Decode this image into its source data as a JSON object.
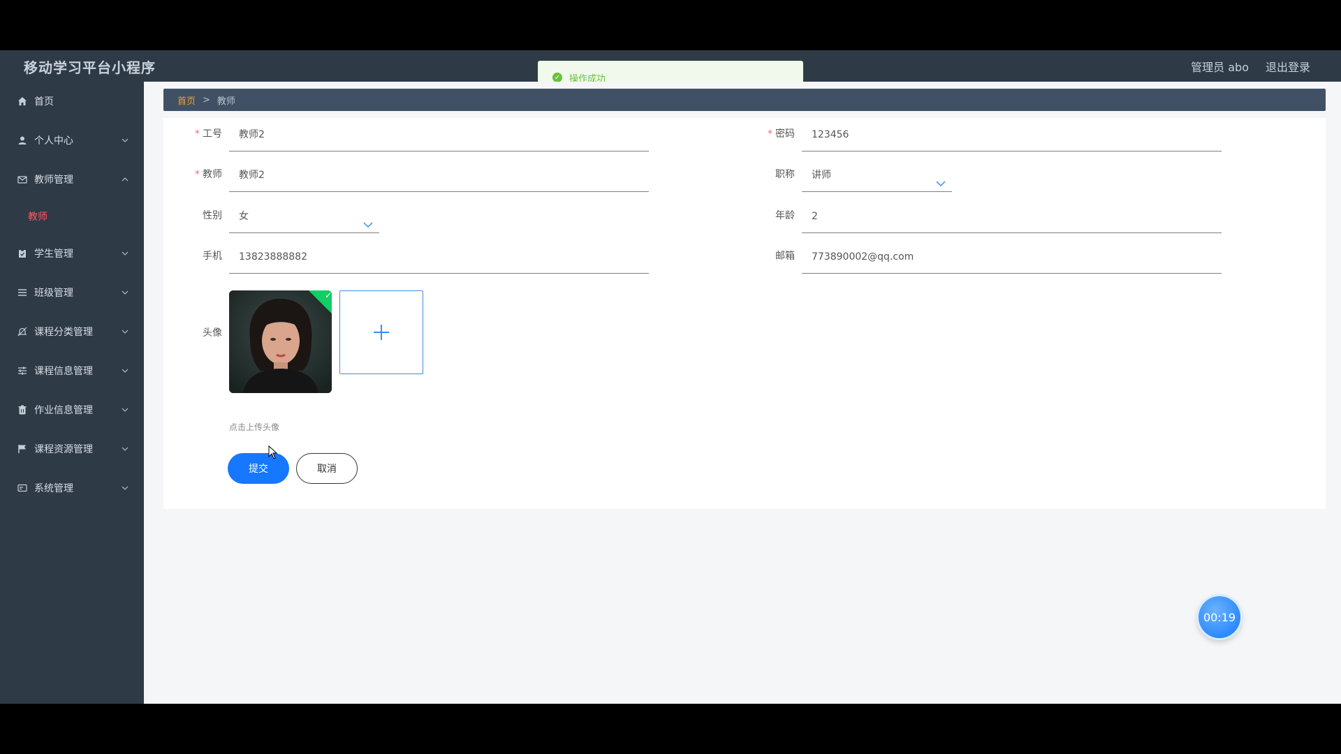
{
  "header": {
    "app_title": "移动学习平台小程序",
    "user_label": "管理员 abo",
    "logout_label": "退出登录"
  },
  "toast": {
    "message": "操作成功"
  },
  "sidebar": {
    "items": [
      {
        "label": "首页",
        "icon": "home-icon"
      },
      {
        "label": "个人中心",
        "icon": "user-icon"
      },
      {
        "label": "教师管理",
        "icon": "mail-icon"
      },
      {
        "label": "学生管理",
        "icon": "clipboard-icon"
      },
      {
        "label": "班级管理",
        "icon": "list-icon"
      },
      {
        "label": "课程分类管理",
        "icon": "bell-icon"
      },
      {
        "label": "课程信息管理",
        "icon": "sliders-icon"
      },
      {
        "label": "作业信息管理",
        "icon": "trash-icon"
      },
      {
        "label": "课程资源管理",
        "icon": "flag-icon"
      },
      {
        "label": "系统管理",
        "icon": "card-icon"
      }
    ],
    "sub_item": "教师"
  },
  "breadcrumb": {
    "home": "首页",
    "separator": ">",
    "current": "教师"
  },
  "form": {
    "employee_id": {
      "label": "工号",
      "value": "教师2"
    },
    "password": {
      "label": "密码",
      "value": "123456"
    },
    "teacher": {
      "label": "教师",
      "value": "教师2"
    },
    "title": {
      "label": "职称",
      "value": "讲师"
    },
    "gender": {
      "label": "性别",
      "value": "女"
    },
    "age": {
      "label": "年龄",
      "value": "2"
    },
    "phone": {
      "label": "手机",
      "value": "13823888882"
    },
    "email": {
      "label": "邮箱",
      "value": "773890002@qq.com"
    },
    "avatar": {
      "label": "头像",
      "hint": "点击上传头像"
    },
    "submit_label": "提交",
    "cancel_label": "取消"
  },
  "timer": {
    "value": "00:19"
  },
  "colors": {
    "sidebar_bg": "#2f3a47",
    "breadcrumb_bg": "#415165",
    "primary": "#1677ff",
    "active_sub": "#ff5a5f",
    "success": "#67c23a"
  }
}
